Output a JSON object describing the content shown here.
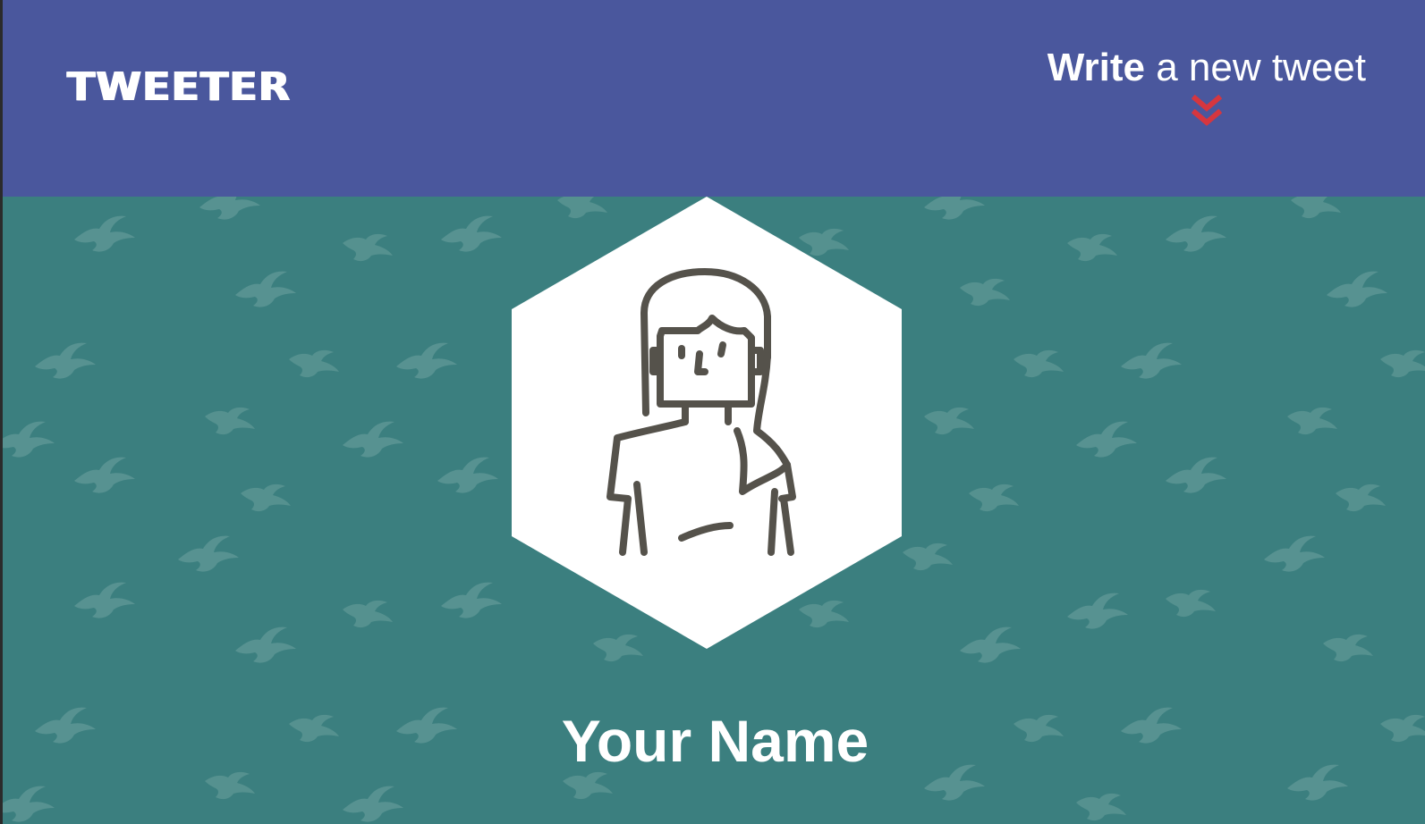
{
  "header": {
    "logo_text": "TWEETER",
    "write_link": {
      "strong": "Write",
      "rest": " a new tweet"
    },
    "chevron_icon": "double-chevron-down-icon",
    "background_color": "#4a579d",
    "chevron_color": "#d6363f"
  },
  "profile": {
    "avatar_icon": "user-avatar-woman-icon",
    "name": "Your Name",
    "background_color": "#3b7f7f",
    "pattern_icon": "bird-icon"
  }
}
